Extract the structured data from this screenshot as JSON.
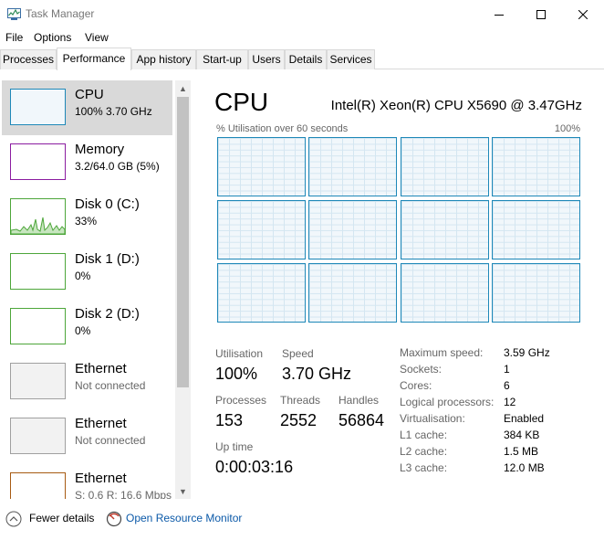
{
  "window": {
    "title": "Task Manager"
  },
  "menu": [
    "File",
    "Options",
    "View"
  ],
  "tabs": [
    "Processes",
    "Performance",
    "App history",
    "Start-up",
    "Users",
    "Details",
    "Services"
  ],
  "sidebar": [
    {
      "title": "CPU",
      "sub": "100%  3.70 GHz",
      "color": "#1e88b8"
    },
    {
      "title": "Memory",
      "sub": "3.2/64.0 GB (5%)",
      "color": "#8b1ca0"
    },
    {
      "title": "Disk 0 (C:)",
      "sub": "33%",
      "color": "#4da63a"
    },
    {
      "title": "Disk 1 (D:)",
      "sub": "0%",
      "color": "#4da63a"
    },
    {
      "title": "Disk 2 (D:)",
      "sub": "0%",
      "color": "#4da63a"
    },
    {
      "title": "Ethernet",
      "sub": "Not connected",
      "color": "#a0a0a0"
    },
    {
      "title": "Ethernet",
      "sub": "Not connected",
      "color": "#a0a0a0"
    },
    {
      "title": "Ethernet",
      "sub": "S: 0.6  R: 16.6 Mbps",
      "color": "#a75a12"
    }
  ],
  "main": {
    "title": "CPU",
    "cpu_name": "Intel(R) Xeon(R) CPU X5690 @ 3.47GHz",
    "graph_caption": "% Utilisation over 60 seconds",
    "graph_max": "100%",
    "stats": {
      "utilisation_label": "Utilisation",
      "utilisation": "100%",
      "speed_label": "Speed",
      "speed": "3.70 GHz",
      "processes_label": "Processes",
      "processes": "153",
      "threads_label": "Threads",
      "threads": "2552",
      "handles_label": "Handles",
      "handles": "56864",
      "uptime_label": "Up time",
      "uptime": "0:00:03:16"
    },
    "specs": [
      {
        "label": "Maximum speed:",
        "value": "3.59 GHz"
      },
      {
        "label": "Sockets:",
        "value": "1"
      },
      {
        "label": "Cores:",
        "value": "6"
      },
      {
        "label": "Logical processors:",
        "value": "12"
      },
      {
        "label": "Virtualisation:",
        "value": "Enabled"
      },
      {
        "label": "L1 cache:",
        "value": "384 KB"
      },
      {
        "label": "L2 cache:",
        "value": "1.5 MB"
      },
      {
        "label": "L3 cache:",
        "value": "12.0 MB"
      }
    ]
  },
  "footer": {
    "fewer_details": "Fewer details",
    "open_resource_monitor": "Open Resource Monitor"
  }
}
